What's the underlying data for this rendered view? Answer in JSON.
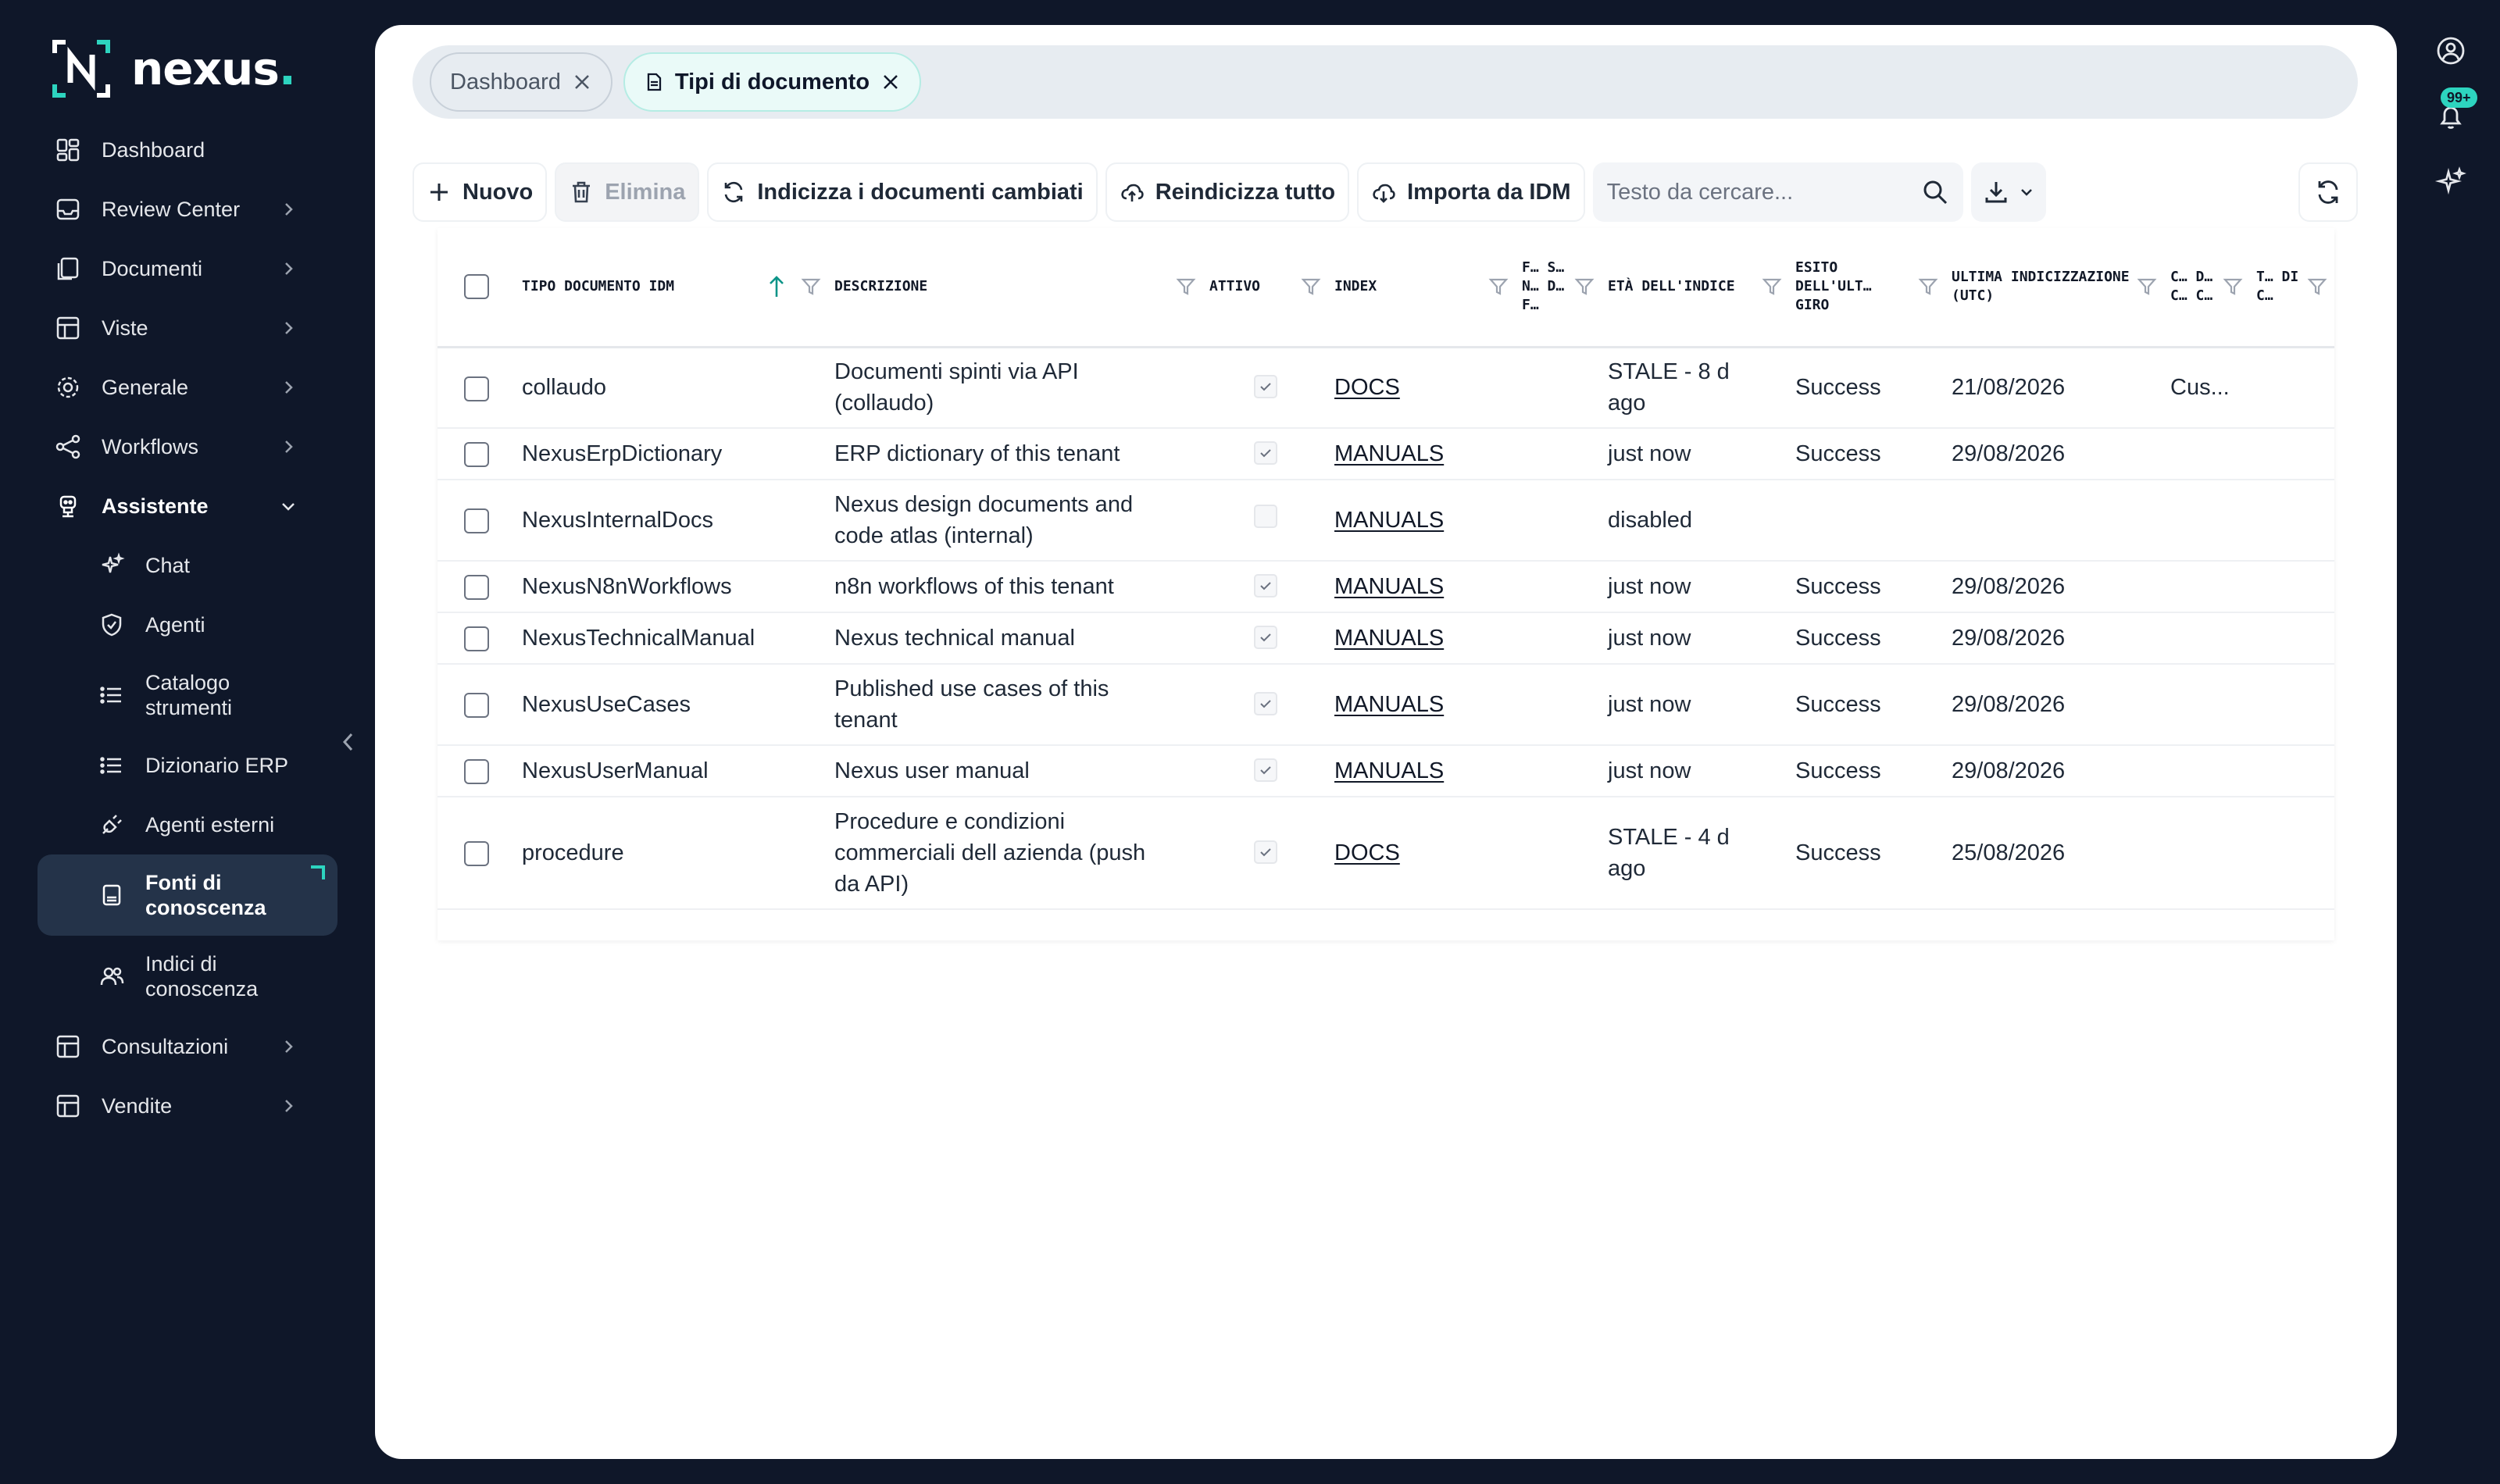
{
  "brand": {
    "name": "nexus",
    "dot": ".",
    "accent": "#2dd4bf"
  },
  "sidebar": {
    "items": [
      {
        "label": "Dashboard",
        "icon": "dashboard-icon"
      },
      {
        "label": "Review Center",
        "icon": "inbox-icon"
      },
      {
        "label": "Documenti",
        "icon": "documents-icon"
      },
      {
        "label": "Viste",
        "icon": "table-icon"
      },
      {
        "label": "Generale",
        "icon": "gear-icon"
      },
      {
        "label": "Workflows",
        "icon": "share-icon"
      },
      {
        "label": "Assistente",
        "icon": "robot-icon"
      }
    ],
    "sub_items": [
      {
        "label": "Chat",
        "icon": "sparkle-icon"
      },
      {
        "label": "Agenti",
        "icon": "shield-icon"
      },
      {
        "label": "Catalogo strumenti",
        "icon": "list-icon"
      },
      {
        "label": "Dizionario ERP",
        "icon": "list-icon"
      },
      {
        "label": "Agenti esterni",
        "icon": "plug-icon"
      },
      {
        "label": "Fonti di conoscenza",
        "icon": "book-icon"
      },
      {
        "label": "Indici di conoscenza",
        "icon": "users-icon"
      }
    ],
    "bottom_items": [
      {
        "label": "Consultazioni",
        "icon": "table-icon"
      },
      {
        "label": "Vendite",
        "icon": "table-icon"
      }
    ]
  },
  "rail": {
    "notifications_badge": "99+"
  },
  "tabs": [
    {
      "label": "Dashboard"
    },
    {
      "label": "Tipi di documento"
    }
  ],
  "toolbar": {
    "new_label": "Nuovo",
    "delete_label": "Elimina",
    "reindex_changed_label": "Indicizza i documenti cambiati",
    "reindex_all_label": "Reindicizza tutto",
    "import_label": "Importa da IDM",
    "search_placeholder": "Testo da cercare..."
  },
  "table": {
    "columns": [
      {
        "label": "Tipo documento IDM"
      },
      {
        "label": "Descrizione"
      },
      {
        "label": "Attivo"
      },
      {
        "label": "Index"
      },
      {
        "label": "F… S… N… D… F…"
      },
      {
        "label": "Età dell'indice"
      },
      {
        "label": "Esito dell'ult… giro"
      },
      {
        "label": "Ultima indicizzazione (UTC)"
      },
      {
        "label": "C… D… C… C…"
      },
      {
        "label": "T… DI C…"
      }
    ],
    "rows": [
      {
        "tipo": "collaudo",
        "descrizione": "Documenti spinti via API (collaudo)",
        "attivo": true,
        "index": "DOCS",
        "age": "STALE - 8 d ago",
        "esito": "Success",
        "ultima": "21/08/2026",
        "extra": "Cus..."
      },
      {
        "tipo": "NexusErpDictionary",
        "descrizione": "ERP dictionary of this tenant",
        "attivo": true,
        "index": "MANUALS",
        "age": "just now",
        "esito": "Success",
        "ultima": "29/08/2026",
        "extra": ""
      },
      {
        "tipo": "NexusInternalDocs",
        "descrizione": "Nexus design documents and code atlas (internal)",
        "attivo": false,
        "index": "MANUALS",
        "age": "disabled",
        "esito": "",
        "ultima": "",
        "extra": ""
      },
      {
        "tipo": "NexusN8nWorkflows",
        "descrizione": "n8n workflows of this tenant",
        "attivo": true,
        "index": "MANUALS",
        "age": "just now",
        "esito": "Success",
        "ultima": "29/08/2026",
        "extra": ""
      },
      {
        "tipo": "NexusTechnicalManual",
        "descrizione": "Nexus technical manual",
        "attivo": true,
        "index": "MANUALS",
        "age": "just now",
        "esito": "Success",
        "ultima": "29/08/2026",
        "extra": ""
      },
      {
        "tipo": "NexusUseCases",
        "descrizione": "Published use cases of this tenant",
        "attivo": true,
        "index": "MANUALS",
        "age": "just now",
        "esito": "Success",
        "ultima": "29/08/2026",
        "extra": ""
      },
      {
        "tipo": "NexusUserManual",
        "descrizione": "Nexus user manual",
        "attivo": true,
        "index": "MANUALS",
        "age": "just now",
        "esito": "Success",
        "ultima": "29/08/2026",
        "extra": ""
      },
      {
        "tipo": "procedure",
        "descrizione": "Procedure e condizioni commerciali dell azienda (push da API)",
        "attivo": true,
        "index": "DOCS",
        "age": "STALE - 4 d ago",
        "esito": "Success",
        "ultima": "25/08/2026",
        "extra": ""
      }
    ]
  }
}
